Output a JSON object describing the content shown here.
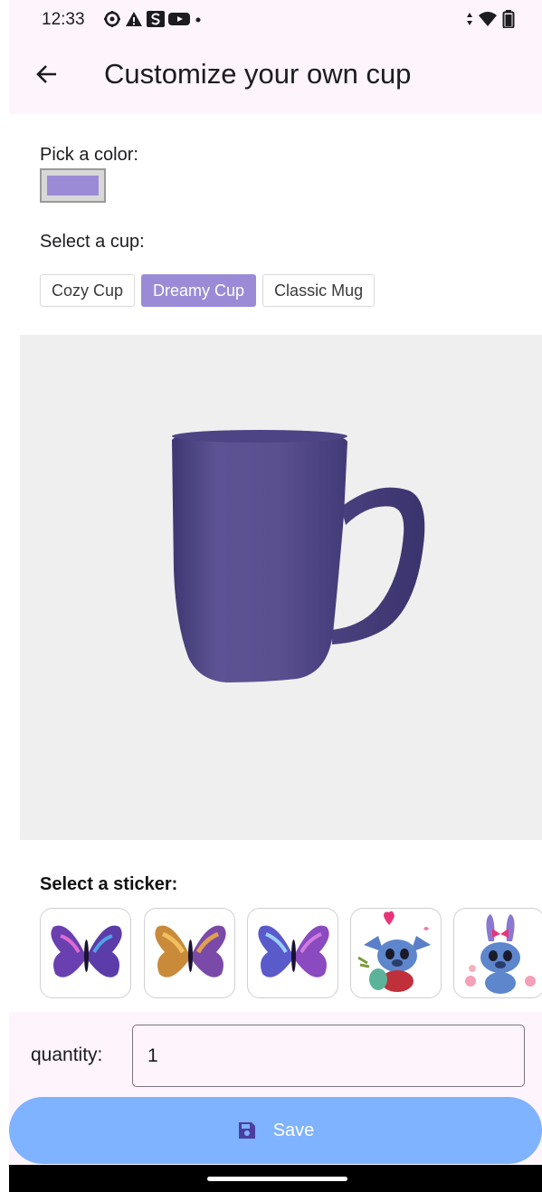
{
  "status_bar": {
    "time": "12:33",
    "left_icons": [
      "settings-icon",
      "alert-icon",
      "s-app-icon",
      "youtube-icon",
      "dot-icon"
    ],
    "right_icons": [
      "data-arrows-icon",
      "wifi-icon",
      "battery-icon"
    ]
  },
  "app_bar": {
    "title": "Customize your own cup",
    "back_icon": "arrow-left-icon"
  },
  "color_picker": {
    "label": "Pick a color:",
    "selected_color": "#9b8bd6"
  },
  "cup_selector": {
    "label": "Select a cup:",
    "options": [
      {
        "label": "Cozy Cup",
        "selected": false
      },
      {
        "label": "Dreamy Cup",
        "selected": true
      },
      {
        "label": "Classic Mug",
        "selected": false
      }
    ]
  },
  "preview": {
    "cup_color": "#5a5090"
  },
  "stickers": {
    "label": "Select a sticker:",
    "items": [
      {
        "name": "butterfly-purple"
      },
      {
        "name": "butterfly-gold"
      },
      {
        "name": "butterfly-blue"
      },
      {
        "name": "stitch-with-heart"
      },
      {
        "name": "stitch-with-bow"
      }
    ]
  },
  "quantity": {
    "label": "quantity:",
    "value": "1"
  },
  "save_button": {
    "label": "Save",
    "icon": "floppy-disk-icon"
  },
  "colors": {
    "accent": "#9b8bd6",
    "save_button_bg": "#7fb2ff",
    "surface": "#fdf4fc"
  }
}
